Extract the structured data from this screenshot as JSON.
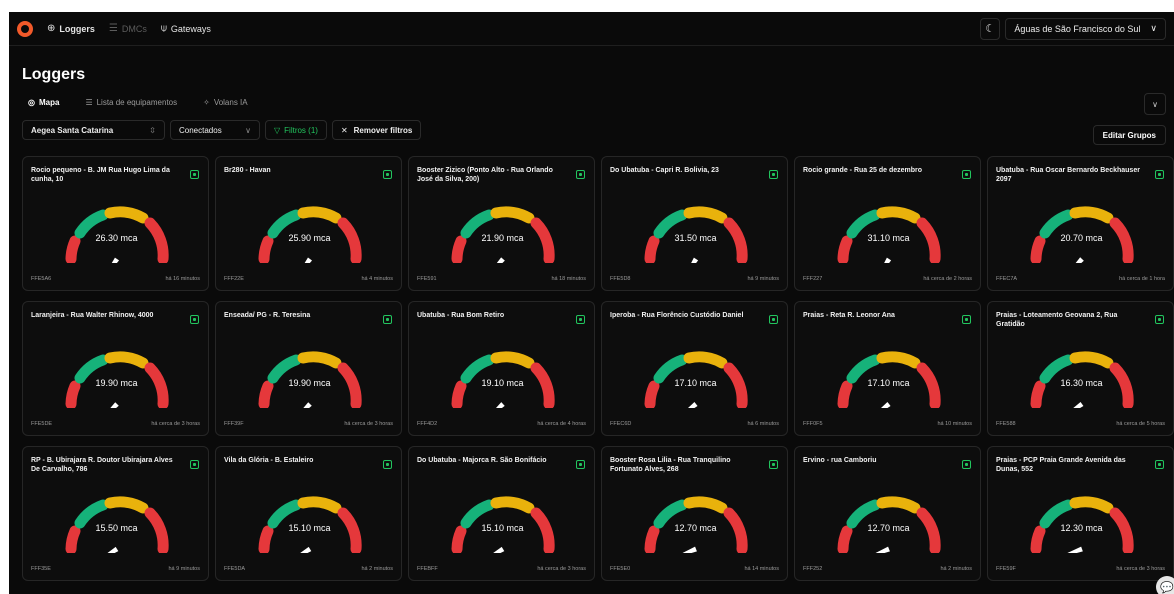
{
  "nav": {
    "items": [
      {
        "label": "Loggers",
        "icon": "chip-icon",
        "glyph": "⊕",
        "active": true
      },
      {
        "label": "DMCs",
        "icon": "list-icon",
        "glyph": "☰",
        "active": false
      },
      {
        "label": "Gateways",
        "icon": "antenna-icon",
        "glyph": "⍦",
        "active": true
      }
    ],
    "theme_glyph": "☾",
    "org": "Águas de São Francisco do Sul",
    "org_chevron": "∨"
  },
  "page": {
    "title": "Loggers",
    "tabs": [
      {
        "label": "Mapa",
        "glyph": "◎",
        "active": true
      },
      {
        "label": "Lista de equipamentos",
        "glyph": "☰",
        "active": false
      },
      {
        "label": "Volans IA",
        "glyph": "✧",
        "active": false
      }
    ],
    "collapse_glyph": "∨"
  },
  "filters": {
    "region": "Aegea Santa Catarina",
    "region_glyph": "⇳",
    "connection": "Conectados",
    "connection_glyph": "∨",
    "filters_label": "Filtros (1)",
    "filters_glyph": "▽",
    "remove_label": "Remover filtros",
    "remove_glyph": "✕",
    "edit_groups": "Editar Grupos"
  },
  "colors": {
    "red": "#e5383b",
    "green": "#16b27a",
    "yellow": "#e9b20c",
    "accent": "#22c55e"
  },
  "loggers": [
    {
      "title": "Rocio pequeno - B. JM Rua Hugo Lima da cunha, 10",
      "value": "26.30 mca",
      "needle_deg": 125,
      "id": "FFE5A6",
      "time": "há 16 minutos"
    },
    {
      "title": "Br280 - Havan",
      "value": "25.90 mca",
      "needle_deg": 126,
      "id": "FFF22E",
      "time": "há 4 minutos"
    },
    {
      "title": "Booster Zizico (Ponto Alto - Rua Orlando José da Silva, 200)",
      "value": "21.90 mca",
      "needle_deg": 132,
      "id": "FFE591",
      "time": "há 18 minutos"
    },
    {
      "title": "Do Ubatuba - Capri R. Bolivia, 23",
      "value": "31.50 mca",
      "needle_deg": 122,
      "id": "FFE5D8",
      "time": "há 9 minutos"
    },
    {
      "title": "Rocio grande - Rua 25 de dezembro",
      "value": "31.10 mca",
      "needle_deg": 122,
      "id": "FFF227",
      "time": "há cerca de 2 horas"
    },
    {
      "title": "Ubatuba - Rua Oscar Bernardo Beckhauser 2097",
      "value": "20.70 mca",
      "needle_deg": 133,
      "id": "FFEC7A",
      "time": "há cerca de 1 hora"
    },
    {
      "title": "Laranjeira - Rua Walter Rhinow, 4000",
      "value": "19.90 mca",
      "needle_deg": 135,
      "id": "FFE5DE",
      "time": "há cerca de 3 horas"
    },
    {
      "title": "Enseada/ PG - R. Teresina",
      "value": "19.90 mca",
      "needle_deg": 135,
      "id": "FFF39F",
      "time": "há cerca de 3 horas"
    },
    {
      "title": "Ubatuba - Rua Bom Retiro",
      "value": "19.10 mca",
      "needle_deg": 137,
      "id": "FFF4D2",
      "time": "há cerca de 4 horas"
    },
    {
      "title": "Iperoba - Rua Florêncio Custódio Daniel",
      "value": "17.10 mca",
      "needle_deg": 142,
      "id": "FFEC6D",
      "time": "há 6 minutos"
    },
    {
      "title": "Praias - Reta R. Leonor Ana",
      "value": "17.10 mca",
      "needle_deg": 142,
      "id": "FFF0F5",
      "time": "há 10 minutos"
    },
    {
      "title": "Praias - Loteamento Geovana 2, Rua Gratidão",
      "value": "16.30 mca",
      "needle_deg": 145,
      "id": "FFE588",
      "time": "há cerca de 5 horas"
    },
    {
      "title": "RP - B. Ubirajara R. Doutor Ubirajara Alves De Carvalho, 786",
      "value": "15.50 mca",
      "needle_deg": 148,
      "id": "FFF35E",
      "time": "há 9 minutos"
    },
    {
      "title": "Vila da Glória - B. Estaleiro",
      "value": "15.10 mca",
      "needle_deg": 149,
      "id": "FFE5DA",
      "time": "há 2 minutos"
    },
    {
      "title": "Do Ubatuba - Majorca R. São Bonifácio",
      "value": "15.10 mca",
      "needle_deg": 149,
      "id": "FFEBFF",
      "time": "há cerca de 3 horas"
    },
    {
      "title": "Booster Rosa Lilia - Rua Tranquilino Fortunato Alves, 268",
      "value": "12.70 mca",
      "needle_deg": 158,
      "id": "FFE5E0",
      "time": "há 14 minutos"
    },
    {
      "title": "Ervino - rua Camboriu",
      "value": "12.70 mca",
      "needle_deg": 158,
      "id": "FFF252",
      "time": "há 2 minutos"
    },
    {
      "title": "Praias - PCP Praia Grande Avenida das Dunas, 552",
      "value": "12.30 mca",
      "needle_deg": 160,
      "id": "FFE59F",
      "time": "há cerca de 3 horas"
    }
  ],
  "chat_glyph": "💬"
}
